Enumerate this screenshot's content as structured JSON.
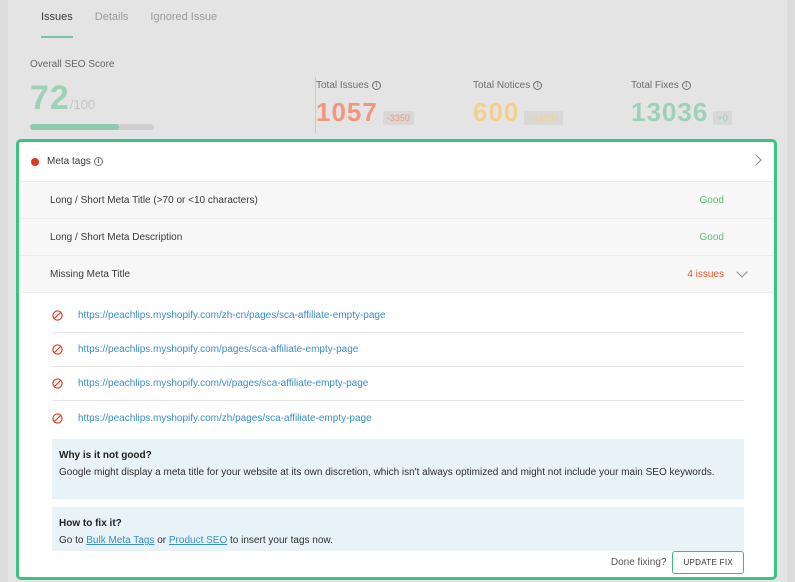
{
  "tabs": [
    {
      "label": "Issues"
    },
    {
      "label": "Details"
    },
    {
      "label": "Ignored Issue"
    }
  ],
  "score": {
    "label": "Overall SEO Score",
    "value": "72",
    "max": "/100",
    "progress": 0.72
  },
  "stats": {
    "issues": {
      "label": "Total Issues",
      "value": "1057",
      "delta": "-3350",
      "color": "#f0987e"
    },
    "notices": {
      "label": "Total Notices",
      "value": "600",
      "delta": "+12093",
      "color": "#f3cf8d"
    },
    "fixes": {
      "label": "Total Fixes",
      "value": "13036",
      "delta": "+0",
      "color": "#9fd1b8"
    }
  },
  "panel": {
    "title": "Meta tags",
    "rules": [
      {
        "label": "Long / Short Meta Title (>70 or <10 characters)",
        "status": "Good"
      },
      {
        "label": "Long / Short Meta Description",
        "status": "Good"
      }
    ],
    "expanded_rule": {
      "label": "Missing Meta Title",
      "issues": "4 issues"
    },
    "urls": [
      "https://peachlips.myshopify.com/zh-cn/pages/sca-affiliate-empty-page",
      "https://peachlips.myshopify.com/pages/sca-affiliate-empty-page",
      "https://peachlips.myshopify.com/vi/pages/sca-affiliate-empty-page",
      "https://peachlips.myshopify.com/zh/pages/sca-affiliate-empty-page"
    ],
    "why": {
      "title": "Why is it not good?",
      "text": "Google might display a meta title for your website at its own discretion, which isn't always optimized and might not include your main SEO keywords."
    },
    "how": {
      "title": "How to fix it?",
      "prefix": "Go to ",
      "link1": "Bulk Meta Tags",
      "middle": " or ",
      "link2": "Product SEO",
      "suffix": " to insert your tags now."
    },
    "footer": {
      "done_text": "Done fixing?",
      "button": "UPDATE FIX"
    }
  },
  "colors": {
    "accent": "#3bc47f",
    "error": "#e0391f",
    "good": "#5cbf6f",
    "link": "#3b8ec6"
  }
}
